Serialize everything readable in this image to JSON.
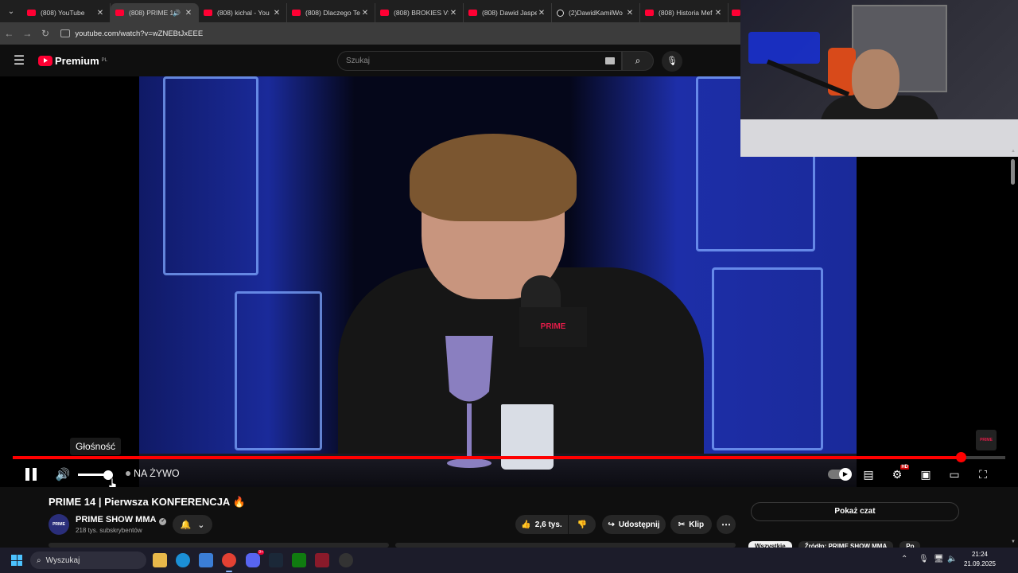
{
  "browser": {
    "tabs": [
      {
        "title": "(808) YouTube",
        "icon": "youtube-icon",
        "active": false,
        "audio": false
      },
      {
        "title": "(808) PRIME 1",
        "icon": "youtube-icon",
        "active": true,
        "audio": true
      },
      {
        "title": "(808) kichal - You",
        "icon": "youtube-icon",
        "active": false,
        "audio": false
      },
      {
        "title": "(808) Dlaczego Te",
        "icon": "youtube-icon",
        "active": false,
        "audio": false
      },
      {
        "title": "(808) BROKIES VS",
        "icon": "youtube-icon",
        "active": false,
        "audio": false
      },
      {
        "title": "(808) Dawid Jaspe",
        "icon": "youtube-icon",
        "active": false,
        "audio": false
      },
      {
        "title": "(2)DawidKamilWo",
        "icon": "tiktok-icon",
        "active": false,
        "audio": false
      },
      {
        "title": "(808) Historia Mef",
        "icon": "youtube-icon",
        "active": false,
        "audio": false
      }
    ],
    "url": "youtube.com/watch?v=wZNEBtJxEEE"
  },
  "youtube": {
    "logo_text": "Premium",
    "logo_region": "PL",
    "search_placeholder": "Szukaj"
  },
  "player": {
    "tooltip": "Głośność",
    "live_label": "NA ŻYWO",
    "progress_fraction": 0.955,
    "volume_fraction": 0.95,
    "hd_badge": "HD",
    "overlay_brand": "PRIME",
    "mic_flag_text": "PRIME"
  },
  "video": {
    "title": "PRIME 14 | Pierwsza KONFERENCJA",
    "title_emoji": "🔥",
    "channel_name": "PRIME SHOW MMA",
    "channel_avatar_text": "PRIME",
    "subscribers": "218 tys. subskrybentów",
    "likes": "2,6 tys.",
    "share_label": "Udostępnij",
    "clip_label": "Klip",
    "show_chat_label": "Pokaż czat"
  },
  "chips": [
    {
      "label": "Wszystkie",
      "selected": true
    },
    {
      "label": "Źródło: PRIME SHOW MMA",
      "selected": false
    },
    {
      "label": "Po",
      "selected": false
    }
  ],
  "taskbar": {
    "search_placeholder": "Wyszukaj",
    "discord_badge": "9+",
    "time": "21:24",
    "date": "21.09.2025"
  }
}
